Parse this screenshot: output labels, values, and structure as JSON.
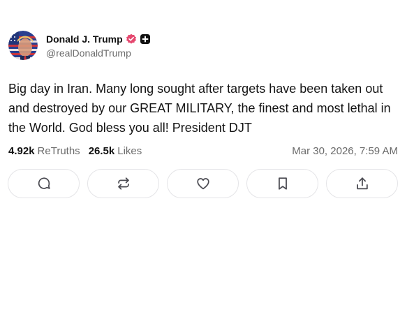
{
  "user": {
    "display_name": "Donald J. Trump",
    "handle": "@realDonaldTrump",
    "verified": true,
    "verified_color": "#e5486f",
    "avatar_icon": "profile-avatar-icon"
  },
  "post": {
    "text": "Big day in Iran. Many long sought after targets have been taken out and destroyed by our GREAT MILITARY, the finest and most lethal in the World. God bless you all! President DJT",
    "timestamp": "Mar 30, 2026, 7:59 AM"
  },
  "stats": {
    "retruths_count": "4.92k",
    "retruths_label": "ReTruths",
    "likes_count": "26.5k",
    "likes_label": "Likes"
  },
  "actions": [
    {
      "name": "reply",
      "icon": "comment-icon"
    },
    {
      "name": "retruth",
      "icon": "repost-icon"
    },
    {
      "name": "like",
      "icon": "heart-icon"
    },
    {
      "name": "bookmark",
      "icon": "bookmark-icon"
    },
    {
      "name": "share",
      "icon": "share-icon"
    }
  ],
  "colors": {
    "text": "#111111",
    "muted": "#6b6b6b",
    "border": "#e4e4e7",
    "icon": "#4b4b52"
  }
}
